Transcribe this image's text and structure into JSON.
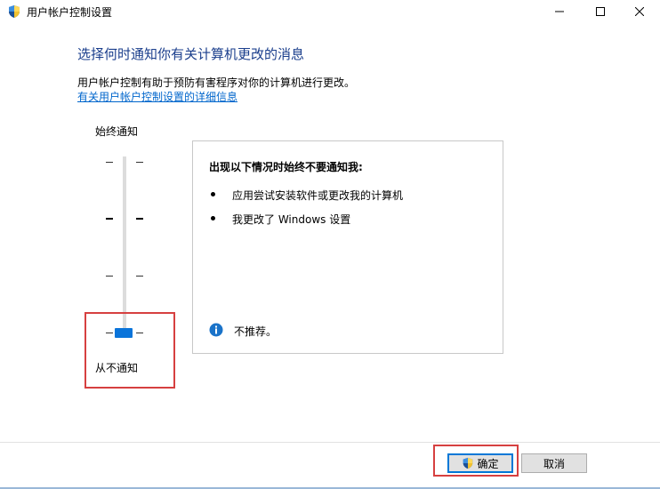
{
  "window": {
    "title": "用户帐户控制设置"
  },
  "content": {
    "heading": "选择何时通知你有关计算机更改的消息",
    "description": "用户帐户控制有助于预防有害程序对你的计算机进行更改。",
    "help_link": "有关用户帐户控制设置的详细信息"
  },
  "slider": {
    "top_label": "始终通知",
    "bottom_label": "从不通知",
    "levels": 4,
    "selected_level": 1,
    "selected_level_note": "lowest of 4 positions"
  },
  "panel": {
    "title": "出现以下情况时始终不要通知我:",
    "bullets": [
      "应用尝试安装软件或更改我的计算机",
      "我更改了 Windows 设置"
    ],
    "info_text": "不推荐。"
  },
  "buttons": {
    "ok": "确定",
    "cancel": "取消"
  },
  "icons": {
    "app": "uac-shield-icon",
    "ok": "uac-shield-icon",
    "info": "info-icon"
  },
  "colors": {
    "heading": "#1a3e8c",
    "link": "#0066cc",
    "thumb": "#0a74da",
    "highlight": "#d64040"
  }
}
